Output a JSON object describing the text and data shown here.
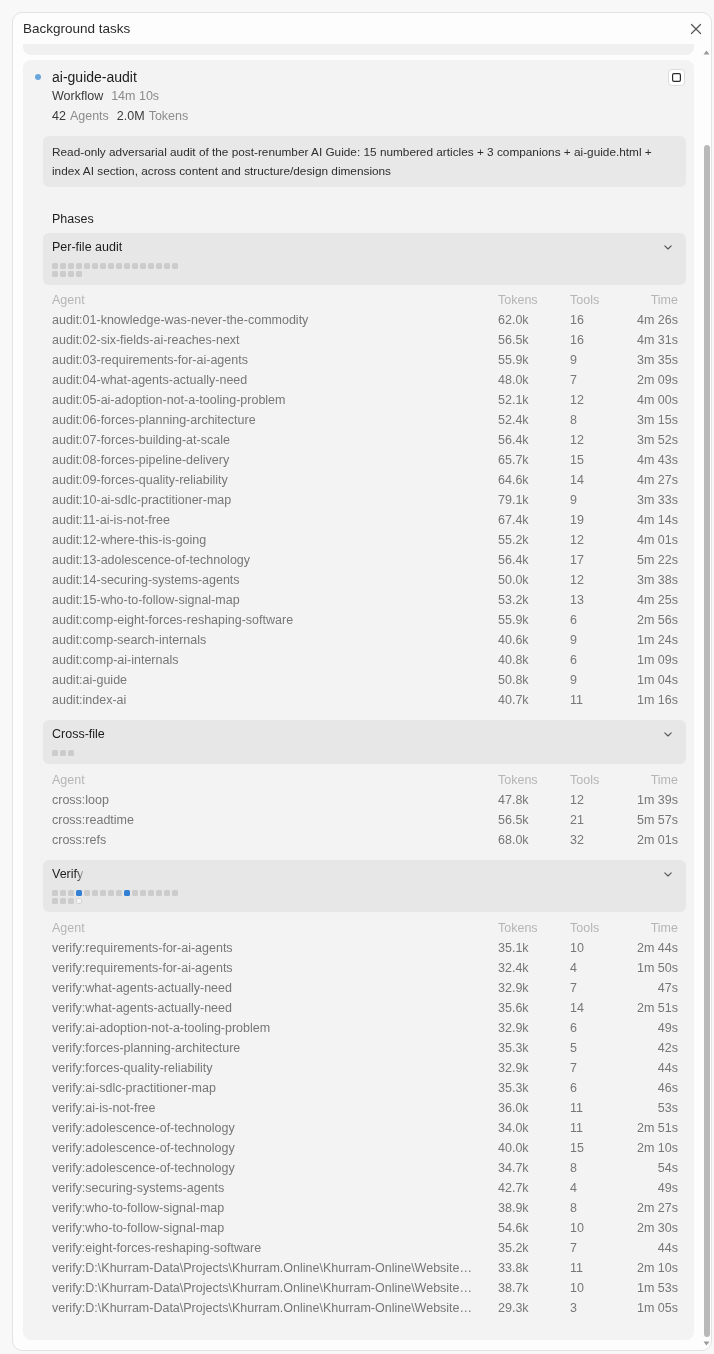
{
  "window": {
    "title": "Background tasks"
  },
  "task": {
    "name": "ai-guide-audit",
    "running": true,
    "type": "Workflow",
    "elapsed": "14m 10s",
    "agents_count": "42",
    "agents_label": "Agents",
    "tokens_count": "2.0M",
    "tokens_label": "Tokens",
    "description": "Read-only adversarial audit of the post-renumber AI Guide: 15 numbered articles + 3 companions + ai-guide.html + index AI section, across content and structure/design dimensions"
  },
  "phases_label": "Phases",
  "phases": [
    {
      "name": "Per-file audit",
      "running": false,
      "expanded": true,
      "agents": [
        {
          "finished": true,
          "running": false
        },
        {
          "finished": true,
          "running": false
        },
        {
          "finished": true,
          "running": false
        },
        {
          "finished": true,
          "running": false
        },
        {
          "finished": true,
          "running": false
        },
        {
          "finished": true,
          "running": false
        },
        {
          "finished": true,
          "running": false
        },
        {
          "finished": true,
          "running": false
        },
        {
          "finished": true,
          "running": false
        },
        {
          "finished": true,
          "running": false
        },
        {
          "finished": true,
          "running": false
        },
        {
          "finished": true,
          "running": false
        },
        {
          "finished": true,
          "running": false
        },
        {
          "finished": true,
          "running": false
        },
        {
          "finished": true,
          "running": false
        },
        {
          "finished": true,
          "running": false
        },
        {
          "finished": true,
          "running": false
        },
        {
          "finished": true,
          "running": false
        },
        {
          "finished": true,
          "running": false
        },
        {
          "finished": true,
          "running": false
        }
      ],
      "columns": [
        "Agent",
        "Tokens",
        "Tools",
        "Time"
      ],
      "rows": [
        [
          "audit:01-knowledge-was-never-the-commodity",
          "62.0k",
          "16",
          "4m 26s"
        ],
        [
          "audit:02-six-fields-ai-reaches-next",
          "56.5k",
          "16",
          "4m 31s"
        ],
        [
          "audit:03-requirements-for-ai-agents",
          "55.9k",
          "9",
          "3m 35s"
        ],
        [
          "audit:04-what-agents-actually-need",
          "48.0k",
          "7",
          "2m 09s"
        ],
        [
          "audit:05-ai-adoption-not-a-tooling-problem",
          "52.1k",
          "12",
          "4m 00s"
        ],
        [
          "audit:06-forces-planning-architecture",
          "52.4k",
          "8",
          "3m 15s"
        ],
        [
          "audit:07-forces-building-at-scale",
          "56.4k",
          "12",
          "3m 52s"
        ],
        [
          "audit:08-forces-pipeline-delivery",
          "65.7k",
          "15",
          "4m 43s"
        ],
        [
          "audit:09-forces-quality-reliability",
          "64.6k",
          "14",
          "4m 27s"
        ],
        [
          "audit:10-ai-sdlc-practitioner-map",
          "79.1k",
          "9",
          "3m 33s"
        ],
        [
          "audit:11-ai-is-not-free",
          "67.4k",
          "19",
          "4m 14s"
        ],
        [
          "audit:12-where-this-is-going",
          "55.2k",
          "12",
          "4m 01s"
        ],
        [
          "audit:13-adolescence-of-technology",
          "56.4k",
          "17",
          "5m 22s"
        ],
        [
          "audit:14-securing-systems-agents",
          "50.0k",
          "12",
          "3m 38s"
        ],
        [
          "audit:15-who-to-follow-signal-map",
          "53.2k",
          "13",
          "4m 25s"
        ],
        [
          "audit:comp-eight-forces-reshaping-software",
          "55.9k",
          "6",
          "2m 56s"
        ],
        [
          "audit:comp-search-internals",
          "40.6k",
          "9",
          "1m 24s"
        ],
        [
          "audit:comp-ai-internals",
          "40.8k",
          "6",
          "1m 09s"
        ],
        [
          "audit:ai-guide",
          "50.8k",
          "9",
          "1m 04s"
        ],
        [
          "audit:index-ai",
          "40.7k",
          "11",
          "1m 16s"
        ]
      ]
    },
    {
      "name": "Cross-file",
      "running": false,
      "expanded": true,
      "agents": [
        {
          "finished": true,
          "running": false
        },
        {
          "finished": true,
          "running": false
        },
        {
          "finished": true,
          "running": false
        }
      ],
      "columns": [
        "Agent",
        "Tokens",
        "Tools",
        "Time"
      ],
      "rows": [
        [
          "cross:loop",
          "47.8k",
          "12",
          "1m 39s"
        ],
        [
          "cross:readtime",
          "56.5k",
          "21",
          "5m 57s"
        ],
        [
          "cross:refs",
          "68.0k",
          "32",
          "2m 01s"
        ]
      ]
    },
    {
      "name": "Verify",
      "running": true,
      "expanded": true,
      "agents": [
        {
          "finished": true,
          "running": false
        },
        {
          "finished": true,
          "running": false
        },
        {
          "finished": true,
          "running": false
        },
        {
          "finished": false,
          "running": true
        },
        {
          "finished": true,
          "running": false
        },
        {
          "finished": true,
          "running": false
        },
        {
          "finished": true,
          "running": false
        },
        {
          "finished": true,
          "running": false
        },
        {
          "finished": true,
          "running": false
        },
        {
          "finished": false,
          "running": true
        },
        {
          "finished": true,
          "running": false
        },
        {
          "finished": true,
          "running": false
        },
        {
          "finished": true,
          "running": false
        },
        {
          "finished": true,
          "running": false
        },
        {
          "finished": true,
          "running": false
        },
        {
          "finished": true,
          "running": false
        },
        {
          "finished": true,
          "running": false
        },
        {
          "finished": true,
          "running": false
        },
        {
          "finished": true,
          "running": false
        },
        {
          "finished": false,
          "running": false
        }
      ],
      "columns": [
        "Agent",
        "Tokens",
        "Tools",
        "Time"
      ],
      "rows": [
        [
          "verify:requirements-for-ai-agents",
          "35.1k",
          "10",
          "2m 44s"
        ],
        [
          "verify:requirements-for-ai-agents",
          "32.4k",
          "4",
          "1m 50s"
        ],
        [
          "verify:what-agents-actually-need",
          "32.9k",
          "7",
          "47s"
        ],
        [
          "verify:what-agents-actually-need",
          "35.6k",
          "14",
          "2m 51s"
        ],
        [
          "verify:ai-adoption-not-a-tooling-problem",
          "32.9k",
          "6",
          "49s"
        ],
        [
          "verify:forces-planning-architecture",
          "35.3k",
          "5",
          "42s"
        ],
        [
          "verify:forces-quality-reliability",
          "32.9k",
          "7",
          "44s"
        ],
        [
          "verify:ai-sdlc-practitioner-map",
          "35.3k",
          "6",
          "46s"
        ],
        [
          "verify:ai-is-not-free",
          "36.0k",
          "11",
          "53s"
        ],
        [
          "verify:adolescence-of-technology",
          "34.0k",
          "11",
          "2m 51s"
        ],
        [
          "verify:adolescence-of-technology",
          "40.0k",
          "15",
          "2m 10s"
        ],
        [
          "verify:adolescence-of-technology",
          "34.7k",
          "8",
          "54s"
        ],
        [
          "verify:securing-systems-agents",
          "42.7k",
          "4",
          "49s"
        ],
        [
          "verify:who-to-follow-signal-map",
          "38.9k",
          "8",
          "2m 27s"
        ],
        [
          "verify:who-to-follow-signal-map",
          "54.6k",
          "10",
          "2m 30s"
        ],
        [
          "verify:eight-forces-reshaping-software",
          "35.2k",
          "7",
          "44s"
        ],
        [
          "verify:D:\\Khurram-Data\\Projects\\Khurram.Online\\Khurram-Online\\Website…",
          "33.8k",
          "11",
          "2m 10s"
        ],
        [
          "verify:D:\\Khurram-Data\\Projects\\Khurram.Online\\Khurram-Online\\Website…",
          "38.7k",
          "10",
          "1m 53s"
        ],
        [
          "verify:D:\\Khurram-Data\\Projects\\Khurram.Online\\Khurram-Online\\Website…",
          "29.3k",
          "3",
          "1m 05s"
        ]
      ]
    }
  ]
}
